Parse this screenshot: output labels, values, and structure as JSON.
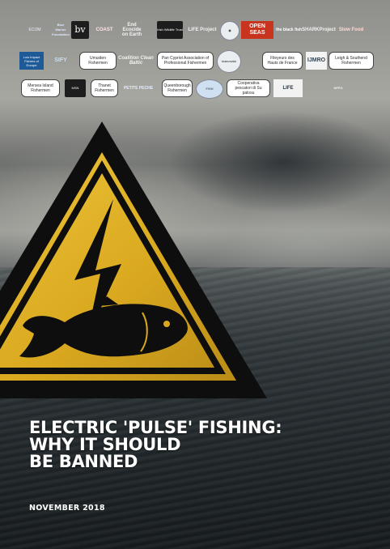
{
  "logos_row1": [
    "ECOM",
    "Blue Marine Foundation",
    "bv",
    "COAST",
    "End Ecocide on Earth",
    "Irish Wildlife Trust",
    "LIFE Project",
    "OPEN SEAS",
    "the black fish",
    "SHARKProject",
    "Slow Food"
  ],
  "logos_row2": [
    "Low Impact Fishers of Europe",
    "SIFY",
    "Umuiden Fishermen",
    "Coalition Clean Baltic",
    "Pan Cypriot Association of Professional Fishermen",
    "Iwanowski",
    "Fileyeurs des Hauts de France",
    "IJMRO",
    "Leigh & Southend Fishermen"
  ],
  "logos_row3": [
    "Mersea Island Fishermen",
    "MSN",
    "Thanet Fishermen",
    "PETITE PECHE",
    "Queenborough Fishermen",
    "FISH",
    "Cooperativa pescatori di Su palosu",
    "LIFE",
    "NFFO"
  ],
  "headline": {
    "line1": "ELECTRIC 'PULSE' FISHING:",
    "line2": "WHY IT SHOULD",
    "line3": "BE BANNED"
  },
  "date": "NOVEMBER 2018",
  "colors": {
    "sign_yellow": "#e7b628",
    "sign_black": "#0e0e0e",
    "text": "#ffffff"
  }
}
